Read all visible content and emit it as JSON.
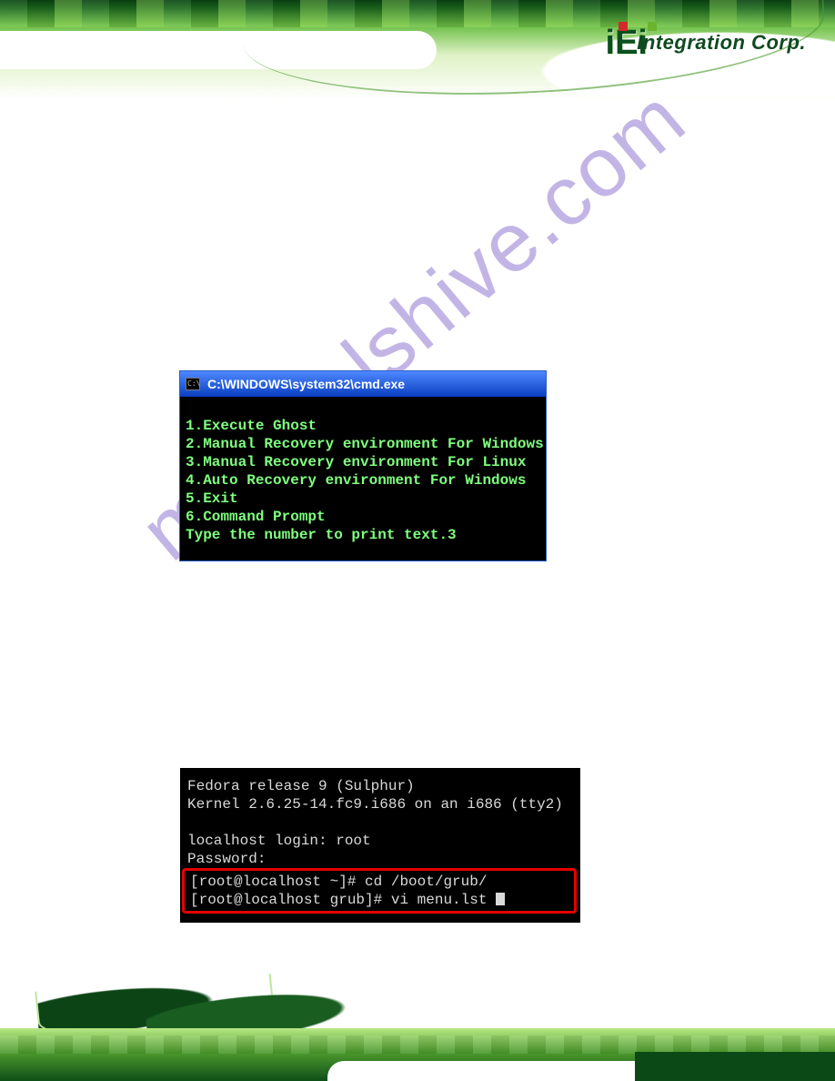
{
  "brand": {
    "logo_text": "iEi",
    "tagline": "Integration Corp."
  },
  "watermark": "manualshive.com",
  "cmd": {
    "title": "C:\\WINDOWS\\system32\\cmd.exe",
    "lines": [
      "1.Execute Ghost",
      "2.Manual Recovery environment For Windows",
      "3.Manual Recovery environment For Linux",
      "4.Auto Recovery environment For Windows",
      "5.Exit",
      "6.Command Prompt",
      "Type the number to print text.3"
    ]
  },
  "tty": {
    "release": "Fedora release 9 (Sulphur)",
    "kernel": "Kernel 2.6.25-14.fc9.i686 on an i686 (tty2)",
    "login": "localhost login: root",
    "password": "Password:",
    "cmd1": "[root@localhost ~]# cd /boot/grub/",
    "cmd2": "[root@localhost grub]# vi menu.lst "
  }
}
